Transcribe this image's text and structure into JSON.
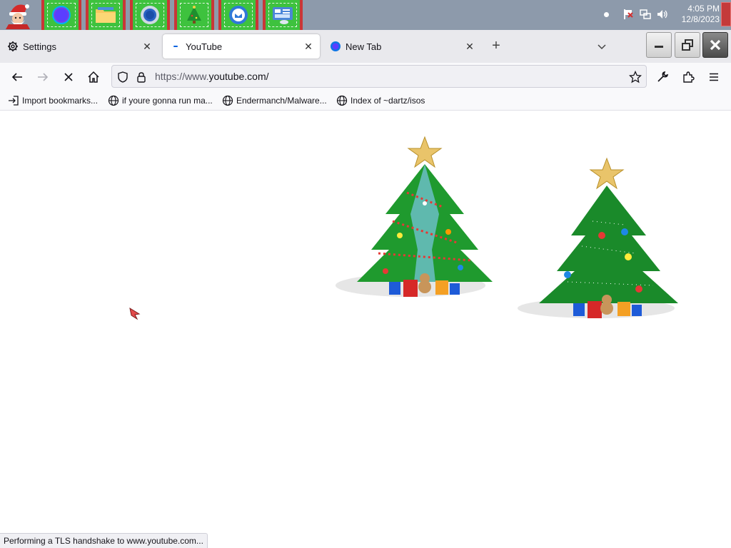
{
  "taskbar": {
    "apps": [
      {
        "name": "browser-app",
        "icon": "firefox-icon"
      },
      {
        "name": "file-explorer-app",
        "icon": "folder-icon"
      },
      {
        "name": "chrome-app",
        "icon": "chrome-icon"
      },
      {
        "name": "christmas-tree-app",
        "icon": "tree-icon"
      },
      {
        "name": "mail-app",
        "icon": "mail-icon"
      },
      {
        "name": "control-panel-app",
        "icon": "control-panel-icon"
      }
    ],
    "clock_time": "4:05 PM",
    "clock_date": "12/8/2023",
    "app_color": "#3ec23e",
    "running_border_color": "#c93636"
  },
  "tabs": [
    {
      "label": "Settings",
      "icon": "gear-icon"
    },
    {
      "label": "YouTube",
      "icon": "loading-icon"
    },
    {
      "label": "New Tab",
      "icon": "firefox-icon"
    }
  ],
  "navbar": {
    "url_prefix": "https://www.",
    "url_domain": "youtube.com/"
  },
  "bookmarks": [
    {
      "label": "Import bookmarks...",
      "icon": "import-icon"
    },
    {
      "label": "if youre gonna run ma...",
      "icon": "globe-icon"
    },
    {
      "label": "Endermanch/Malware...",
      "icon": "globe-icon"
    },
    {
      "label": "Index of ~dartz/isos",
      "icon": "globe-icon"
    }
  ],
  "status": "Performing a TLS handshake to www.youtube.com...",
  "colors": {
    "accent": "#0060df",
    "taskbar": "#8d9aab"
  }
}
